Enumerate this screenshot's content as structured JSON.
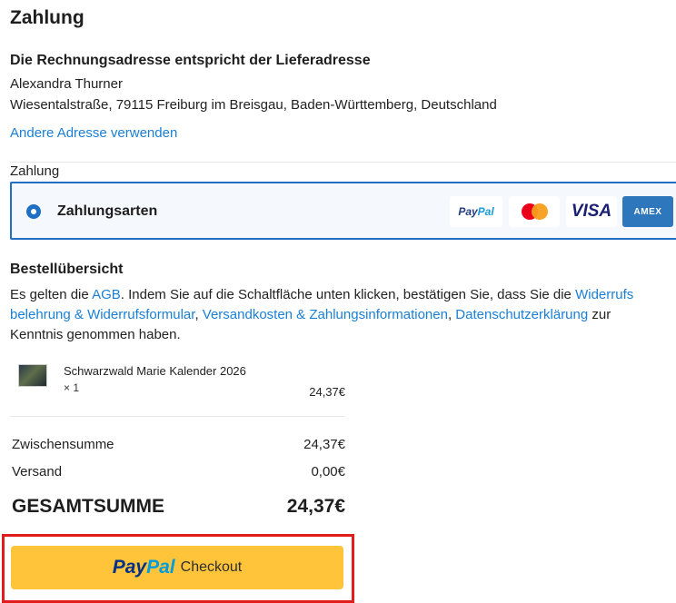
{
  "page": {
    "title": "Zahlung"
  },
  "address": {
    "heading": "Die Rechnungsadresse entspricht der Lieferadresse",
    "name": "Alexandra Thurner",
    "line": "Wiesentalstraße, 79115 Freiburg im Breisgau, Baden-Württemberg, Deutschland",
    "change_link": "Andere Adresse verwenden"
  },
  "payment": {
    "label": "Zahlung",
    "method": "Zahlungsarten",
    "selected": true,
    "cards": {
      "paypal_pay": "Pay",
      "paypal_pal": "Pal",
      "visa": "VISA",
      "amex": "AMEX"
    },
    "colors": {
      "border": "#1f6fc4",
      "mc_red": "#eb001b",
      "mc_orange": "#f79e1b"
    }
  },
  "order": {
    "heading": "Bestellübersicht",
    "terms": {
      "t1": "Es gelten die ",
      "agb": "AGB",
      "t2": ". Indem Sie auf die Schaltfläche unten klicken, bestätigen Sie, dass Sie die ",
      "widerruf_a": "Widerrufs",
      "widerruf_b": "belehrung & Widerrufsformular",
      "sep1": ", ",
      "versand": "Versandkosten & Zahlungsinformationen",
      "sep2": ", ",
      "datenschutz": "Datenschutzerklärung",
      "t3": " zur",
      "t4": "Kenntnis genommen haben."
    },
    "item": {
      "name": "Schwarzwald Marie Kalender 2026",
      "qty": "× 1",
      "price": "24,37€"
    },
    "subtotal_label": "Zwischensumme",
    "subtotal_value": "24,37€",
    "shipping_label": "Versand",
    "shipping_value": "0,00€",
    "total_label": "GESAMTSUMME",
    "total_value": "24,37€"
  },
  "checkout": {
    "logo_pay": "Pay",
    "logo_pal": "Pal",
    "label": "Checkout",
    "colors": {
      "button": "#ffc439",
      "highlight": "#e21b1b"
    }
  }
}
